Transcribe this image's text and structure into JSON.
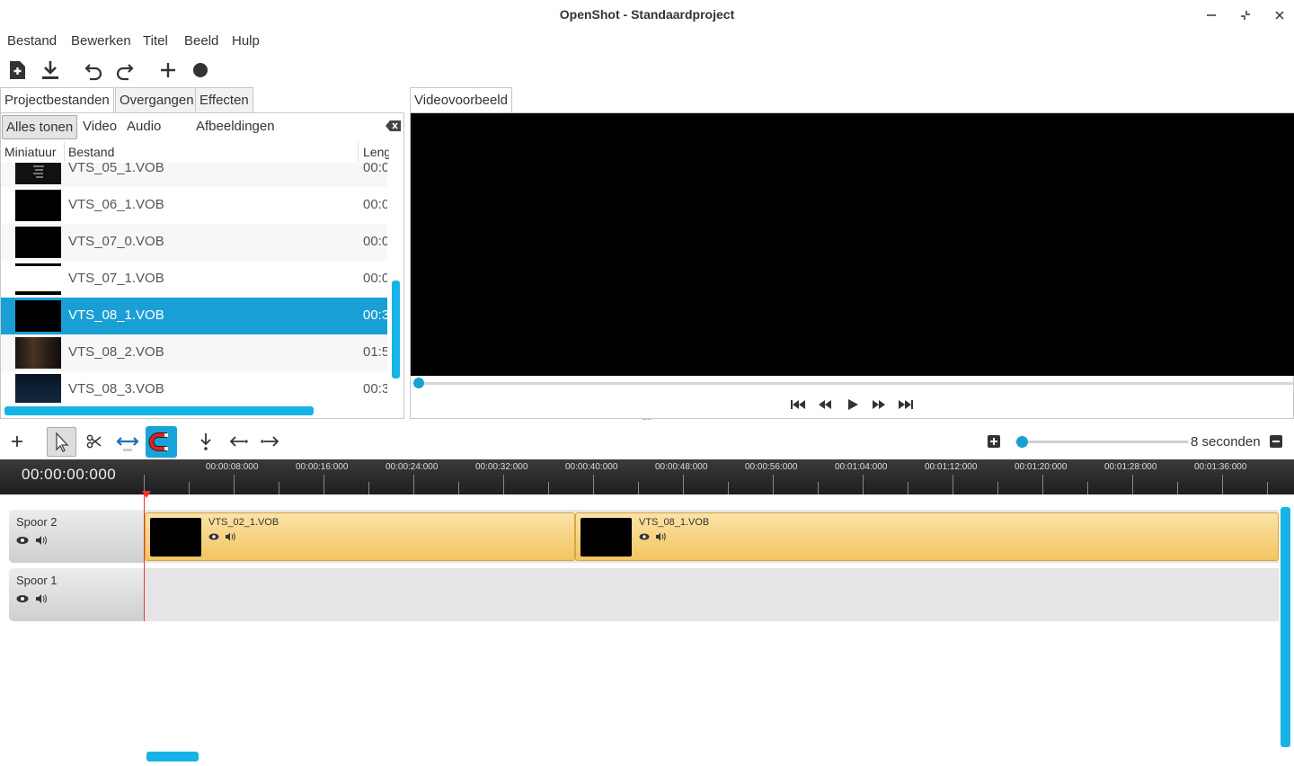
{
  "window": {
    "title": "OpenShot - Standaardproject"
  },
  "menu": [
    "Bestand",
    "Bewerken",
    "Titel",
    "Beeld",
    "Hulp"
  ],
  "toolbar": {
    "icons": [
      "new-file-icon",
      "save-icon",
      "undo-icon",
      "redo-icon",
      "add-icon",
      "record-icon"
    ]
  },
  "left_panel": {
    "tabs": [
      "Projectbestanden",
      "Overgangen",
      "Effecten"
    ],
    "active_tab": "Projectbestanden",
    "filters": [
      "Alles tonen",
      "Video",
      "Audio",
      "Afbeeldingen"
    ],
    "active_filter": "Alles tonen",
    "search_value": "",
    "columns": [
      "Miniatuur",
      "Bestand",
      "Lengte"
    ],
    "files": [
      {
        "name": "VTS_05_1.VOB",
        "length": "00:0"
      },
      {
        "name": "VTS_06_1.VOB",
        "length": "00:0"
      },
      {
        "name": "VTS_07_0.VOB",
        "length": "00:0"
      },
      {
        "name": "VTS_07_1.VOB",
        "length": "00:0"
      },
      {
        "name": "VTS_08_1.VOB",
        "length": "00:3",
        "selected": true
      },
      {
        "name": "VTS_08_2.VOB",
        "length": "01:5"
      },
      {
        "name": "VTS_08_3.VOB",
        "length": "00:3"
      }
    ]
  },
  "preview": {
    "tab": "Videovoorbeeld",
    "controls": [
      "jump-start-icon",
      "rewind-icon",
      "play-icon",
      "fast-forward-icon",
      "jump-end-icon"
    ]
  },
  "timeline": {
    "zoom_label": "8 seconden",
    "timecode": "00:00:00:000",
    "ruler_labels": [
      "00:00:08:000",
      "00:00:16:000",
      "00:00:24:000",
      "00:00:32:000",
      "00:00:40:000",
      "00:00:48:000",
      "00:00:56:000",
      "00:01:04:000",
      "00:01:12:000",
      "00:01:20:000",
      "00:01:28:000",
      "00:01:36:000"
    ],
    "tracks": [
      {
        "name": "Spoor 2",
        "clips": [
          {
            "title": "VTS_02_1.VOB"
          },
          {
            "title": "VTS_08_1.VOB"
          }
        ]
      },
      {
        "name": "Spoor 1",
        "clips": []
      }
    ]
  },
  "colors": {
    "accent": "#1a9fd4",
    "clip": "#f2c560",
    "playhead": "#e33333"
  }
}
